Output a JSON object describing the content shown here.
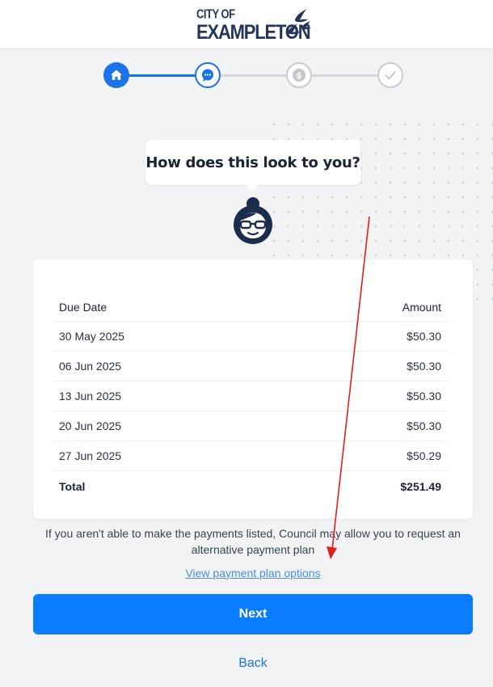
{
  "header": {
    "logo_line1": "CITY OF",
    "logo_line2": "EXAMPLETON",
    "logo_icon": "birds-icon"
  },
  "stepper": {
    "current_step": 2,
    "total_steps": 4,
    "steps": [
      {
        "icon": "home-icon",
        "state": "done"
      },
      {
        "icon": "chat-icon",
        "state": "current"
      },
      {
        "icon": "dollar-icon",
        "state": "todo"
      },
      {
        "icon": "check-icon",
        "state": "todo"
      }
    ]
  },
  "prompt": {
    "question": "How does this look to you?"
  },
  "schedule": {
    "col_date": "Due Date",
    "col_amount": "Amount",
    "rows": [
      {
        "date": "30 May 2025",
        "amount": "$50.30"
      },
      {
        "date": "06 Jun 2025",
        "amount": "$50.30"
      },
      {
        "date": "13 Jun 2025",
        "amount": "$50.30"
      },
      {
        "date": "20 Jun 2025",
        "amount": "$50.30"
      },
      {
        "date": "27 Jun 2025",
        "amount": "$50.29"
      }
    ],
    "total_label": "Total",
    "total_amount": "$251.49"
  },
  "info_text": "If you aren't able to make the payments listed, Council may allow you to request an alternative payment plan",
  "link_text": "View payment plan options",
  "next_label": "Next",
  "back_label": "Back",
  "colors": {
    "primary": "#0a7cff",
    "step_active": "#1a73e8",
    "step_inactive": "#c9ccd1",
    "annotation_arrow": "#e02020"
  }
}
